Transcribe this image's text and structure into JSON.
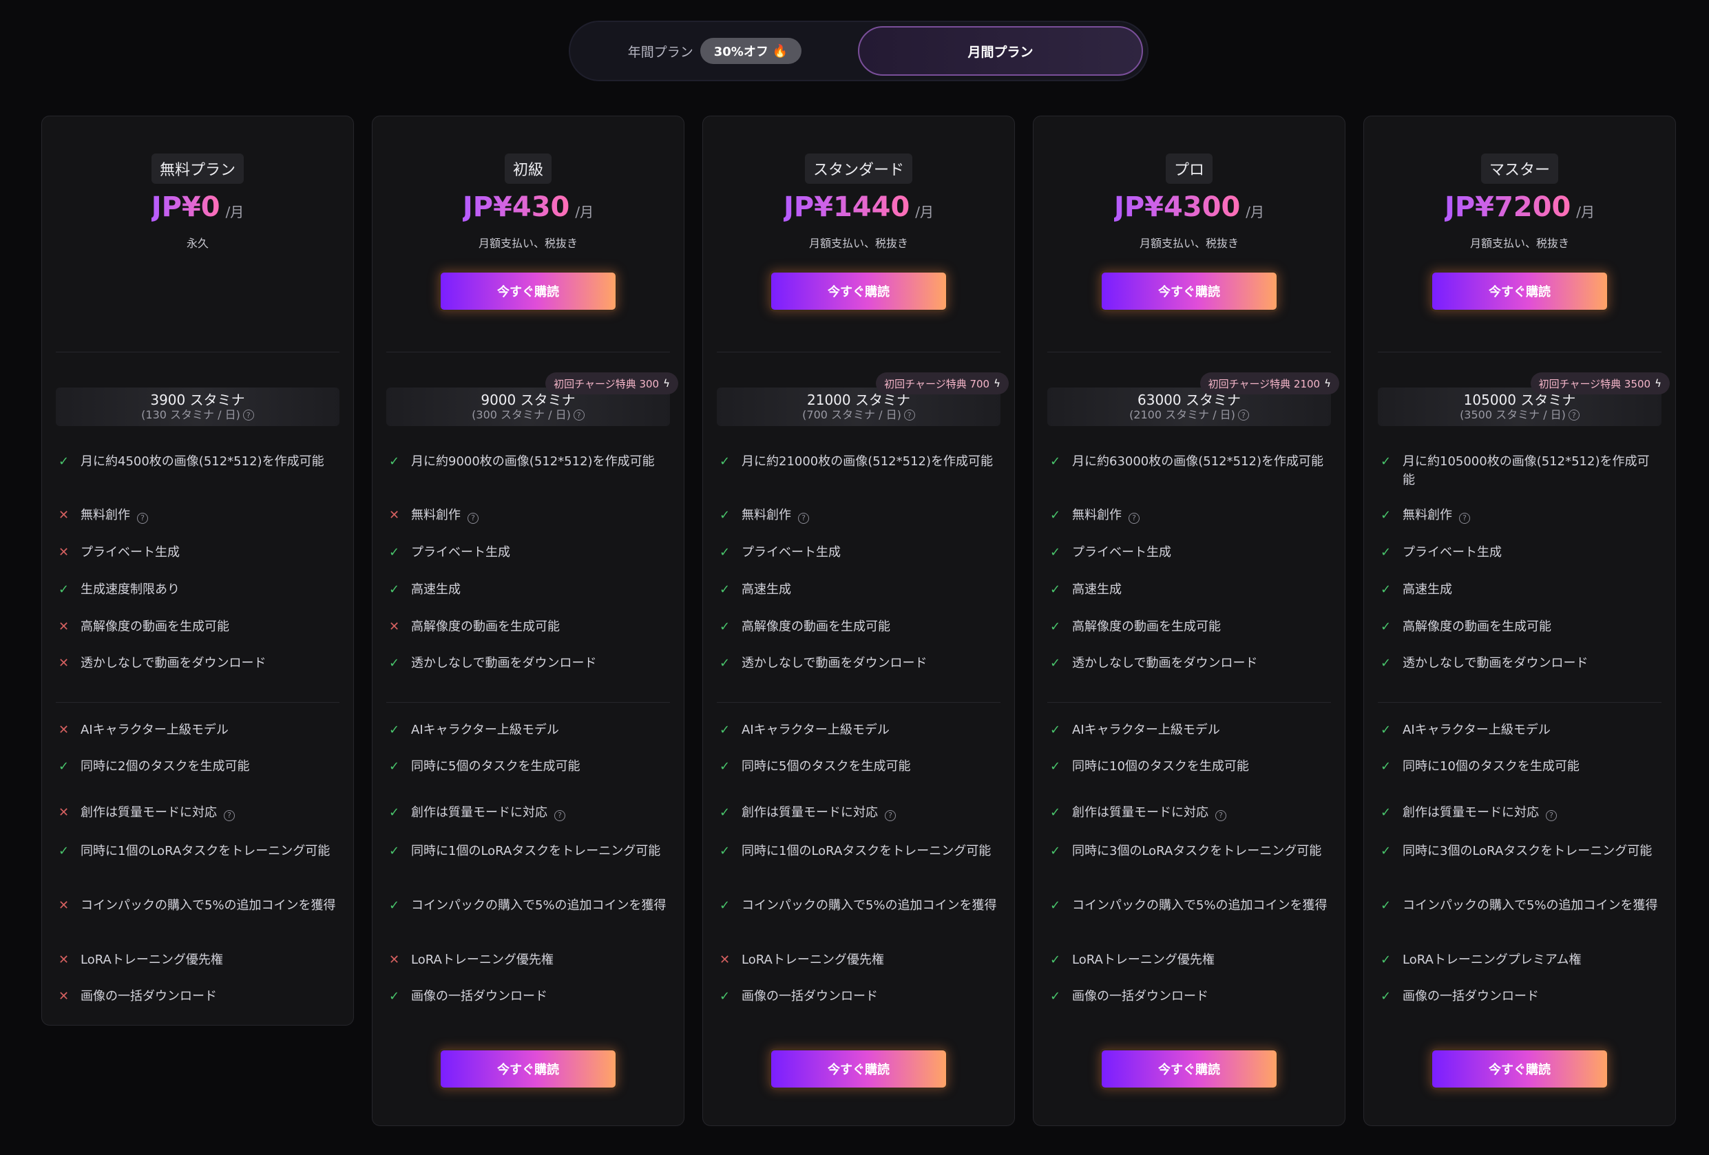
{
  "toggle": {
    "yearly_label": "年間プラン",
    "discount_label": "30%オフ",
    "fire_icon": "🔥",
    "monthly_label": "月間プラン"
  },
  "colors": {
    "ok": "#49c66c",
    "no": "#d56060"
  },
  "plans": [
    {
      "name": "無料プラン",
      "price": "JP¥0",
      "per": "/月",
      "billing": "永久",
      "cta": "",
      "stamina": "3900 スタミナ",
      "stamina_daily": "(130 スタミナ / 日)",
      "bonus": "",
      "features_a": [
        {
          "text": "月に約4500枚の画像(512*512)を作成可能",
          "ok": true
        },
        {
          "text": "無料創作",
          "ok": false,
          "help": true
        },
        {
          "text": "プライベート生成",
          "ok": false
        },
        {
          "text": "生成速度制限あり",
          "ok": true
        },
        {
          "text": "高解像度の動画を生成可能",
          "ok": false
        },
        {
          "text": "透かしなしで動画をダウンロード",
          "ok": false
        }
      ],
      "features_b": [
        {
          "text": "AIキャラクター上級モデル",
          "ok": false
        },
        {
          "text": "同時に2個のタスクを生成可能",
          "ok": true
        },
        {
          "text": "創作は質量モードに対応",
          "ok": false,
          "help": true
        },
        {
          "text": "同時に1個のLoRAタスクをトレーニング可能",
          "ok": true
        },
        {
          "text": "コインパックの購入で5%の追加コインを獲得",
          "ok": false
        },
        {
          "text": "LoRAトレーニング優先権",
          "ok": false
        },
        {
          "text": "画像の一括ダウンロード",
          "ok": false
        }
      ],
      "bottom_cta": ""
    },
    {
      "name": "初級",
      "price": "JP¥430",
      "per": "/月",
      "billing": "月額支払い、税抜き",
      "cta": "今すぐ購読",
      "stamina": "9000 スタミナ",
      "stamina_daily": "(300 スタミナ / 日)",
      "bonus": "初回チャージ特典 300",
      "features_a": [
        {
          "text": "月に約9000枚の画像(512*512)を作成可能",
          "ok": true
        },
        {
          "text": "無料創作",
          "ok": false,
          "help": true
        },
        {
          "text": "プライベート生成",
          "ok": true
        },
        {
          "text": "高速生成",
          "ok": true
        },
        {
          "text": "高解像度の動画を生成可能",
          "ok": false
        },
        {
          "text": "透かしなしで動画をダウンロード",
          "ok": true
        }
      ],
      "features_b": [
        {
          "text": "AIキャラクター上級モデル",
          "ok": true
        },
        {
          "text": "同時に5個のタスクを生成可能",
          "ok": true
        },
        {
          "text": "創作は質量モードに対応",
          "ok": true,
          "help": true
        },
        {
          "text": "同時に1個のLoRAタスクをトレーニング可能",
          "ok": true
        },
        {
          "text": "コインパックの購入で5%の追加コインを獲得",
          "ok": true
        },
        {
          "text": "LoRAトレーニング優先権",
          "ok": false
        },
        {
          "text": "画像の一括ダウンロード",
          "ok": true
        }
      ],
      "bottom_cta": "今すぐ購読"
    },
    {
      "name": "スタンダード",
      "price": "JP¥1440",
      "per": "/月",
      "billing": "月額支払い、税抜き",
      "cta": "今すぐ購読",
      "stamina": "21000 スタミナ",
      "stamina_daily": "(700 スタミナ / 日)",
      "bonus": "初回チャージ特典 700",
      "features_a": [
        {
          "text": "月に約21000枚の画像(512*512)を作成可能",
          "ok": true
        },
        {
          "text": "無料創作",
          "ok": true,
          "help": true
        },
        {
          "text": "プライベート生成",
          "ok": true
        },
        {
          "text": "高速生成",
          "ok": true
        },
        {
          "text": "高解像度の動画を生成可能",
          "ok": true
        },
        {
          "text": "透かしなしで動画をダウンロード",
          "ok": true
        }
      ],
      "features_b": [
        {
          "text": "AIキャラクター上級モデル",
          "ok": true
        },
        {
          "text": "同時に5個のタスクを生成可能",
          "ok": true
        },
        {
          "text": "創作は質量モードに対応",
          "ok": true,
          "help": true
        },
        {
          "text": "同時に1個のLoRAタスクをトレーニング可能",
          "ok": true
        },
        {
          "text": "コインパックの購入で5%の追加コインを獲得",
          "ok": true
        },
        {
          "text": "LoRAトレーニング優先権",
          "ok": false
        },
        {
          "text": "画像の一括ダウンロード",
          "ok": true
        }
      ],
      "bottom_cta": "今すぐ購読"
    },
    {
      "name": "プロ",
      "price": "JP¥4300",
      "per": "/月",
      "billing": "月額支払い、税抜き",
      "cta": "今すぐ購読",
      "stamina": "63000 スタミナ",
      "stamina_daily": "(2100 スタミナ / 日)",
      "bonus": "初回チャージ特典 2100",
      "features_a": [
        {
          "text": "月に約63000枚の画像(512*512)を作成可能",
          "ok": true
        },
        {
          "text": "無料創作",
          "ok": true,
          "help": true
        },
        {
          "text": "プライベート生成",
          "ok": true
        },
        {
          "text": "高速生成",
          "ok": true
        },
        {
          "text": "高解像度の動画を生成可能",
          "ok": true
        },
        {
          "text": "透かしなしで動画をダウンロード",
          "ok": true
        }
      ],
      "features_b": [
        {
          "text": "AIキャラクター上級モデル",
          "ok": true
        },
        {
          "text": "同時に10個のタスクを生成可能",
          "ok": true
        },
        {
          "text": "創作は質量モードに対応",
          "ok": true,
          "help": true
        },
        {
          "text": "同時に3個のLoRAタスクをトレーニング可能",
          "ok": true
        },
        {
          "text": "コインパックの購入で5%の追加コインを獲得",
          "ok": true
        },
        {
          "text": "LoRAトレーニング優先権",
          "ok": true
        },
        {
          "text": "画像の一括ダウンロード",
          "ok": true
        }
      ],
      "bottom_cta": "今すぐ購読"
    },
    {
      "name": "マスター",
      "price": "JP¥7200",
      "per": "/月",
      "billing": "月額支払い、税抜き",
      "cta": "今すぐ購読",
      "stamina": "105000 スタミナ",
      "stamina_daily": "(3500 スタミナ / 日)",
      "bonus": "初回チャージ特典 3500",
      "features_a": [
        {
          "text": "月に約105000枚の画像(512*512)を作成可能",
          "ok": true
        },
        {
          "text": "無料創作",
          "ok": true,
          "help": true
        },
        {
          "text": "プライベート生成",
          "ok": true
        },
        {
          "text": "高速生成",
          "ok": true
        },
        {
          "text": "高解像度の動画を生成可能",
          "ok": true
        },
        {
          "text": "透かしなしで動画をダウンロード",
          "ok": true
        }
      ],
      "features_b": [
        {
          "text": "AIキャラクター上級モデル",
          "ok": true
        },
        {
          "text": "同時に10個のタスクを生成可能",
          "ok": true
        },
        {
          "text": "創作は質量モードに対応",
          "ok": true,
          "help": true
        },
        {
          "text": "同時に3個のLoRAタスクをトレーニング可能",
          "ok": true
        },
        {
          "text": "コインパックの購入で5%の追加コインを獲得",
          "ok": true
        },
        {
          "text": "LoRAトレーニングプレミアム権",
          "ok": true
        },
        {
          "text": "画像の一括ダウンロード",
          "ok": true
        }
      ],
      "bottom_cta": "今すぐ購読"
    }
  ]
}
